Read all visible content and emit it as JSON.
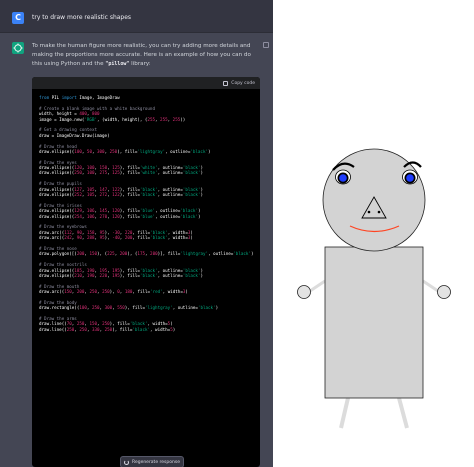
{
  "user_message": {
    "avatar_letter": "C",
    "text": "try to draw more realistic shapes"
  },
  "assistant_message": {
    "intro_before": "To make the human figure more realistic, you can try adding more details and making the proportions more accurate. Here is an example of how you can do this using Python and the ",
    "library_name": "\"pillow\"",
    "intro_after": " library:",
    "code_block": {
      "copy_label": "Copy code",
      "lines": [
        "from PIL import Image, ImageDraw",
        "",
        "# Create a blank image with a white background",
        "width, height = 400, 800",
        "image = Image.new('RGB', (width, height), (255, 255, 255))",
        "",
        "# Get a drawing context",
        "draw = ImageDraw.Draw(image)",
        "",
        "# Draw the head",
        "draw.ellipse((100, 50, 300, 250), fill='lightgray', outline='black')",
        "",
        "# Draw the eyes",
        "draw.ellipse((120, 100, 150, 125), fill='white', outline='black')",
        "draw.ellipse((250, 100, 275, 125), fill='white', outline='black')",
        "",
        "# Draw the pupils",
        "draw.ellipse((127, 105, 147, 122), fill='black', outline='black')",
        "draw.ellipse((252, 105, 272, 122), fill='black', outline='black')",
        "",
        "# Draw the irises",
        "draw.ellipse((129, 106, 145, 120), fill='blue', outline='black')",
        "draw.ellipse((254, 106, 270, 120), fill='blue', outline='black')",
        "",
        "# Draw the eyebrows",
        "draw.arc((112, 90, 158, 95), -30, 220, fill='black', width=3)",
        "draw.arc((242, 90, 288, 95), -40, 200, fill='black', width=3)",
        "",
        "# Draw the nose",
        "draw.polygon([(200, 150), (225, 200), (175, 200)], fill='lightgray', outline='black')",
        "",
        "# Draw the nostrils",
        "draw.ellipse((185, 190, 195, 195), fill='black', outline='black')",
        "draw.ellipse((210, 190, 220, 195), fill='black', outline='black')",
        "",
        "# Draw the mouth",
        "draw.arc((150, 200, 250, 250), 0, 180, fill='red', width=3)",
        "",
        "# Draw the body",
        "draw.rectangle((100, 250, 300, 550), fill='lightgray', outline='black')",
        "",
        "# Draw the arms",
        "draw.line((70, 250, 150, 250), fill='black', width=5)",
        "draw.line((250, 250, 330, 250), fill='black', width=5)"
      ]
    },
    "regenerate_label": "Regenerate response"
  },
  "colors": {
    "chat_dark": "#343541",
    "chat_assistant": "#444654",
    "code_bg": "#000000",
    "comment": "#8e8ea0",
    "keyword": "#2e95d3",
    "number": "#df3079",
    "string": "#00a67d",
    "figure_gray": "#d3d3d3",
    "iris_blue": "#1e3cff",
    "mouth_red": "#ff4422",
    "limb_gray": "#dcdcdc"
  },
  "icons": {
    "user_avatar": "letter-avatar",
    "assistant_avatar": "openai-logo-icon",
    "copy": "clipboard-icon",
    "regenerate": "refresh-icon"
  }
}
